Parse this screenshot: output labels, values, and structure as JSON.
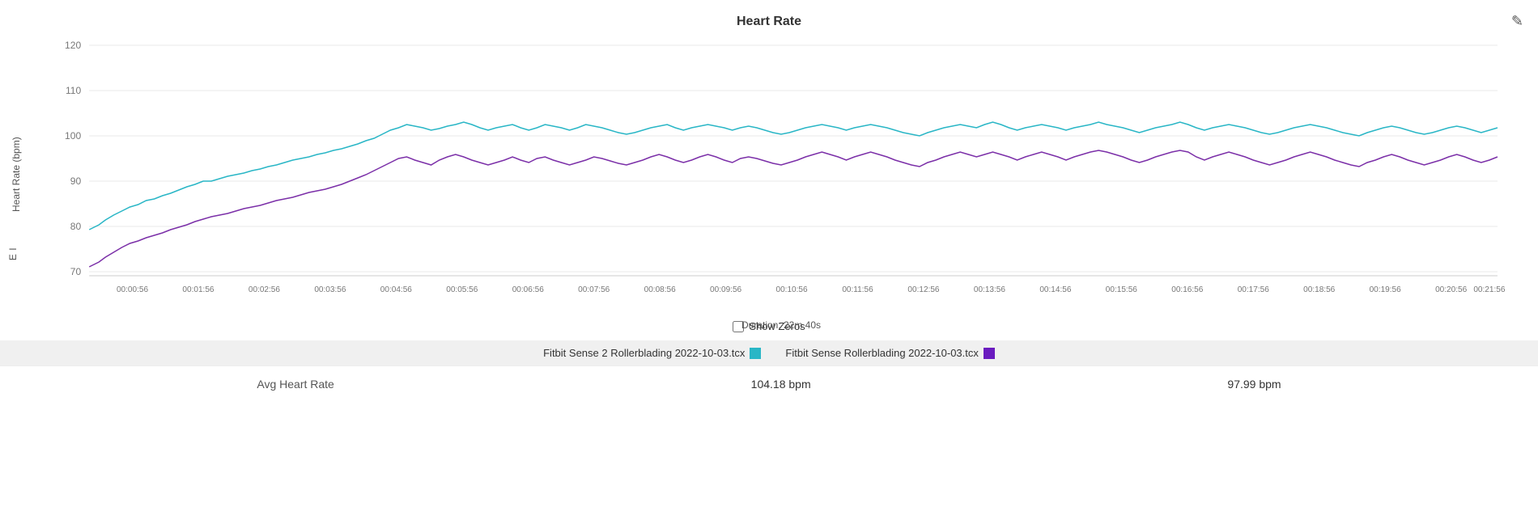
{
  "title": "Heart Rate",
  "yAxisLabel": "Heart Rate (bpm)",
  "xAxisLabel": "Duration: 22m 40s",
  "editIcon": "✎",
  "showZerosLabel": "Show Zeros",
  "legend": [
    {
      "id": "sense2",
      "label": "Fitbit Sense 2 Rollerblading 2022-10-03.tcx",
      "color": "#29b6c6"
    },
    {
      "id": "sense",
      "label": "Fitbit Sense Rollerblading 2022-10-03.tcx",
      "color": "#6a1bbf"
    }
  ],
  "stats": [
    {
      "label": "Avg Heart Rate",
      "values": [
        "104.18 bpm",
        "97.99 bpm"
      ]
    }
  ],
  "xTicks": [
    "00:00:56",
    "00:01:56",
    "00:02:56",
    "00:03:56",
    "00:04:56",
    "00:05:56",
    "00:06:56",
    "00:07:56",
    "00:08:56",
    "00:09:56",
    "00:10:56",
    "00:11:56",
    "00:12:56",
    "00:13:56",
    "00:14:56",
    "00:15:56",
    "00:16:56",
    "00:17:56",
    "00:18:56",
    "00:19:56",
    "00:20:56",
    "00:21:56"
  ],
  "yTicks": [
    70,
    80,
    90,
    100,
    110,
    120
  ],
  "colors": {
    "sense2": "#29b6c6",
    "sense": "#7b2fa8",
    "grid": "#e8e8e8",
    "axis": "#999"
  },
  "verticalLabel": "E I"
}
